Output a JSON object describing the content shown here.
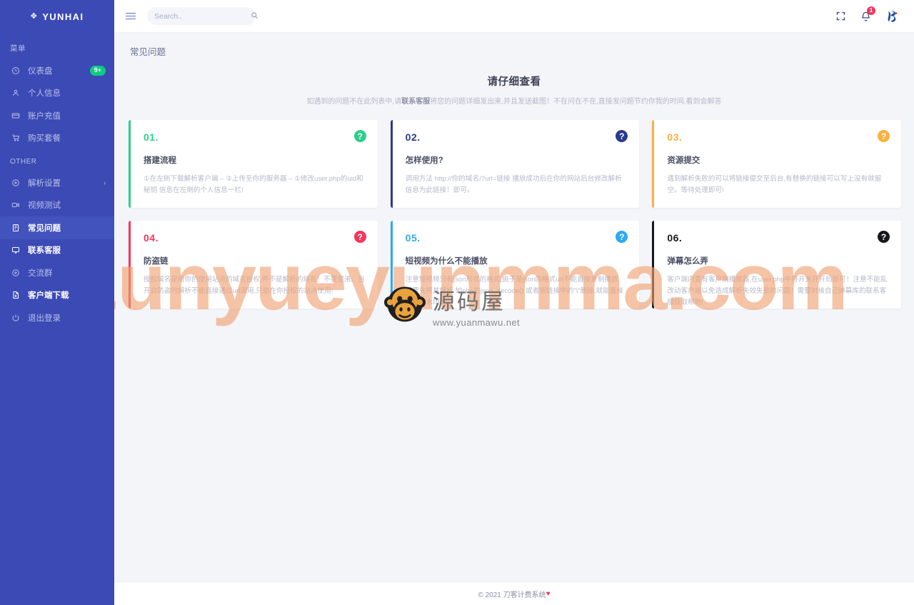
{
  "brand": {
    "name": "YUNHAI",
    "icon": "move-crosshair-icon"
  },
  "sidebar": {
    "section_menu": "菜单",
    "section_other": "OTHER",
    "menu_items": [
      {
        "label": "仪表盘",
        "icon": "clock-icon",
        "badge": "9+"
      },
      {
        "label": "个人信息",
        "icon": "user-icon",
        "badge": ""
      },
      {
        "label": "账户充值",
        "icon": "card-icon",
        "badge": ""
      },
      {
        "label": "购买套餐",
        "icon": "cart-icon",
        "badge": ""
      }
    ],
    "other_items": [
      {
        "label": "解析设置",
        "icon": "settings-gear-icon",
        "chevron": "›",
        "active": false,
        "strong": false
      },
      {
        "label": "视频测试",
        "icon": "video-camera-icon",
        "chevron": "",
        "active": false,
        "strong": false
      },
      {
        "label": "常见问题",
        "icon": "book-icon",
        "chevron": "",
        "active": true,
        "strong": true
      },
      {
        "label": "联系客服",
        "icon": "chat-icon",
        "chevron": "",
        "active": false,
        "strong": true
      },
      {
        "label": "交流群",
        "icon": "plus-circle-icon",
        "chevron": "",
        "active": false,
        "strong": false
      },
      {
        "label": "客户端下载",
        "icon": "file-download-icon",
        "chevron": "",
        "active": false,
        "strong": true
      },
      {
        "label": "退出登录",
        "icon": "power-icon",
        "chevron": "",
        "active": false,
        "strong": false
      }
    ]
  },
  "topbar": {
    "menu_toggle": "hamburger-icon",
    "search": {
      "value": "",
      "placeholder": "Search.."
    },
    "search_icon": "search-icon",
    "fullscreen_icon": "fullscreen-expand-icon",
    "bell_icon": "bell-icon",
    "bell_badge": "1",
    "avatar_icon": "user-avatar-logo"
  },
  "main": {
    "page_title": "常见问题",
    "intro_heading": "请仔细查看",
    "intro_text_before": "如遇到的问题不在此列表中,请",
    "intro_text_bold": "联系客服",
    "intro_text_after": "将您的问题详细发出来,并且发送截图！不在问在不在,直接发问题节约你我的时间,看到会解答",
    "cards": [
      {
        "num": "01.",
        "title": "搭建流程",
        "body": "①在左侧下载解析客户端 – ②上传至你的服务器 – ①修改user.php的uid和秘钥 信息在左侧的个人信息一栏!",
        "color": "#2dce89",
        "qmark": "?"
      },
      {
        "num": "02.",
        "title": "怎样使用?",
        "body": "调用方法 http://你的域名/?url=链接 播放成功后在你的网站后台修改解析信息为此链接！即可。",
        "color": "#2b3a8f",
        "qmark": "?"
      },
      {
        "num": "03.",
        "title": "资源提交",
        "body": "遇到解析失败的可以将链接提交至后台,有替换的链接可以写上没有就留空。等待处理即可!",
        "color": "#fbb040",
        "qmark": "?"
      },
      {
        "num": "04.",
        "title": "防盗链",
        "body": "授权域名是给你的使用站点的域名授权,并不是解析的域名！不要混淆。当开启防盗时解析不能直接通过url调用,只能在你授权的站点使用!",
        "color": "#f5365c",
        "qmark": "?"
      },
      {
        "num": "05.",
        "title": "短视频为什么不能播放",
        "body": "注意短视频只有json形式的格式,由于是json的格式url不能直接复制播放,需要先将其解析 如php的json_decode() 或者将链接中的\"\\\"删除,就能直接播放无水印的",
        "color": "#2eaaf0",
        "qmark": "?"
      },
      {
        "num": "06.",
        "title": "弹幕怎么弄",
        "body": "客户端内置有客户端播放器,在user.php中将开关开开后即可！注意不能乱改动客户端以免造成解析失效失败的问题！需要对接自己弹幕库的联系客服获取帮助!",
        "color": "#16181c",
        "qmark": "?"
      }
    ]
  },
  "footer": {
    "copyright": "© 2021 刀客计费系统",
    "heart": "♥"
  },
  "watermark": {
    "text": "zunyueyunmma.com",
    "logo_cn": "源码屋",
    "logo_url": "www.yuanmawu.net",
    "logo_icon": "monkey-logo-icon"
  }
}
